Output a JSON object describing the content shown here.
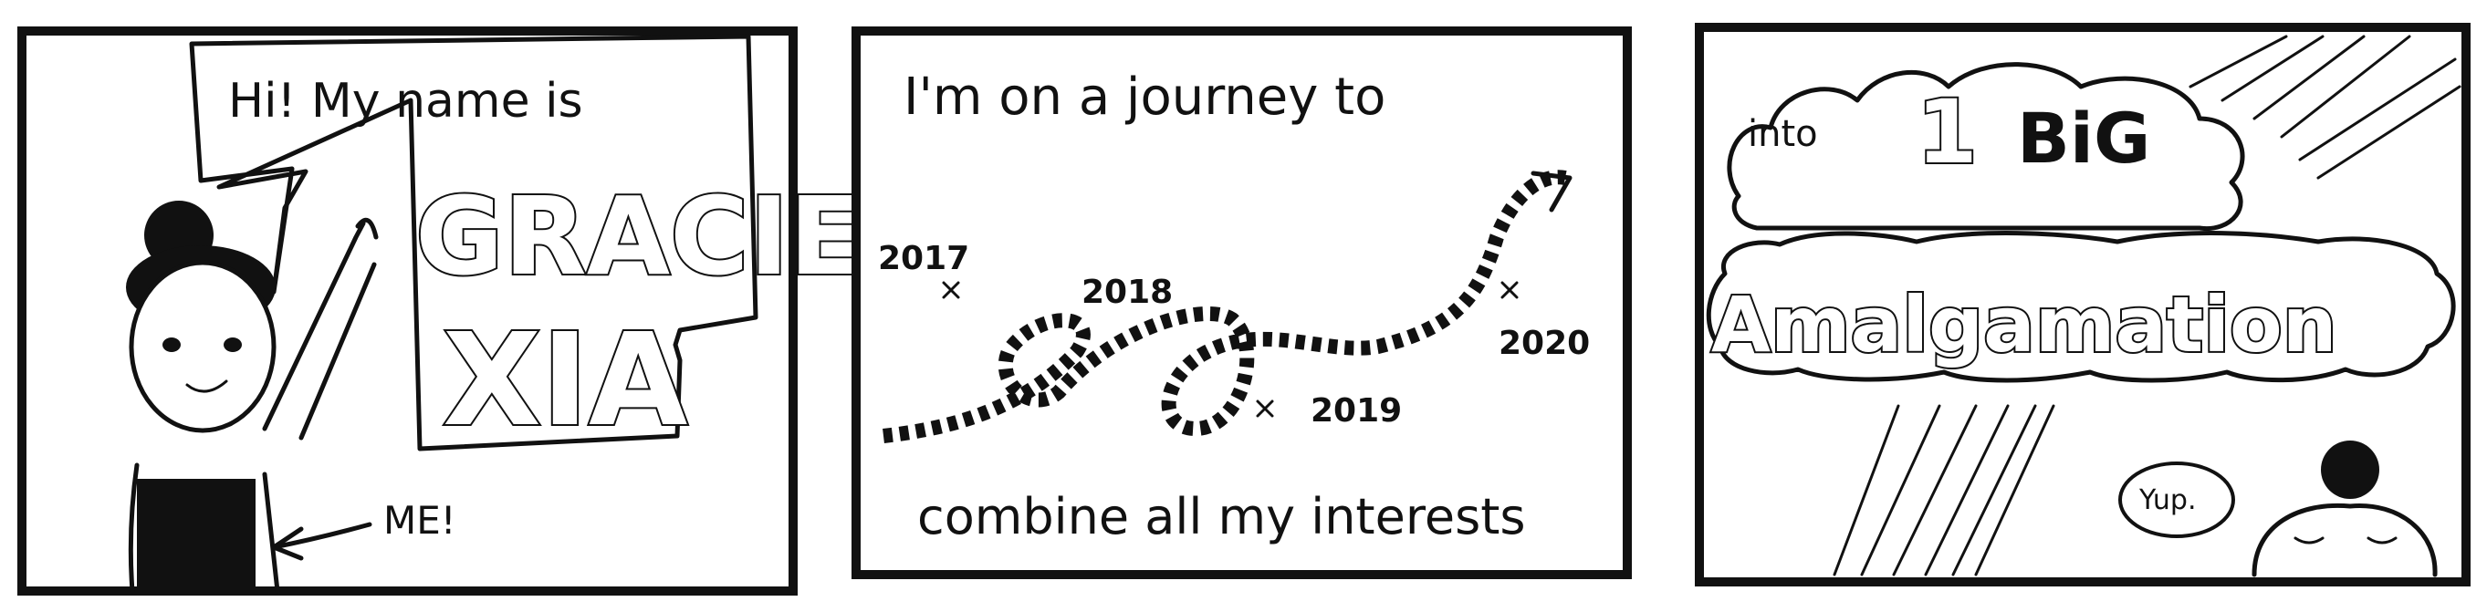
{
  "panel1": {
    "greeting": "Hi! My name is",
    "name_line1": "GRACIE",
    "name_line2": "XIA",
    "me_label": "ME!"
  },
  "panel2": {
    "top_text": "I'm on a journey to",
    "bottom_text": "combine all my interests",
    "years": [
      "2017",
      "2018",
      "2019",
      "2020"
    ]
  },
  "panel3": {
    "into_text": "into",
    "number_text": "1",
    "big_text": "BiG",
    "amalgamation_text": "Amalgamation",
    "yup_text": "Yup."
  }
}
